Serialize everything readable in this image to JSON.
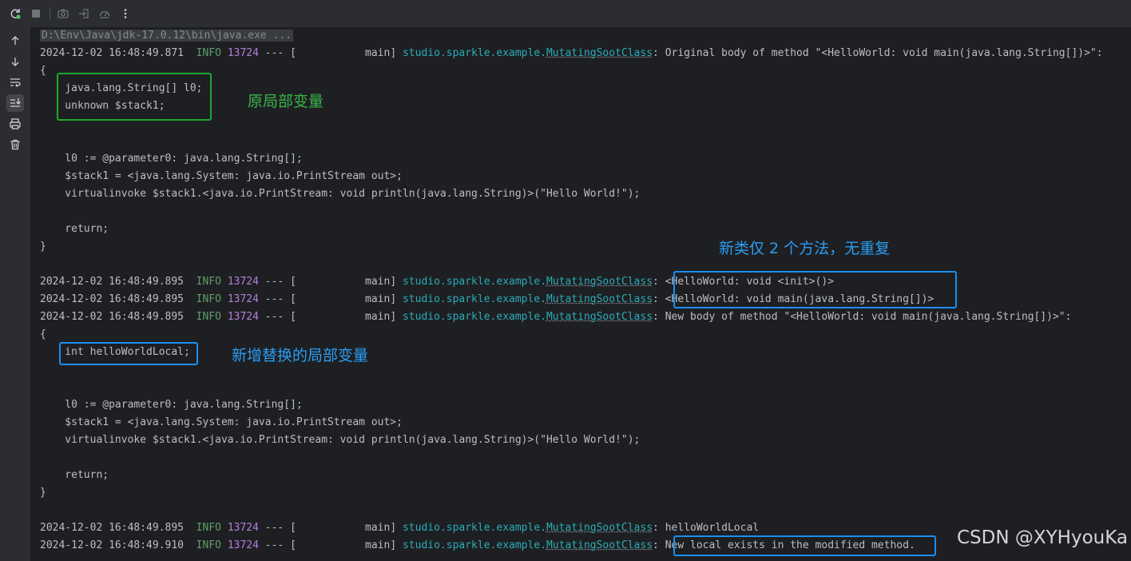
{
  "toolbar": {
    "buttons": [
      {
        "name": "rerun-icon"
      },
      {
        "name": "stop-icon"
      },
      {
        "name": "camera-icon"
      },
      {
        "name": "login-icon"
      },
      {
        "name": "gauge-icon"
      },
      {
        "name": "more-vertical-icon"
      }
    ]
  },
  "sidebar": {
    "buttons": [
      {
        "name": "arrow-up-icon"
      },
      {
        "name": "arrow-down-icon"
      },
      {
        "name": "soft-wrap-icon"
      },
      {
        "name": "scroll-to-end-icon",
        "active": true
      },
      {
        "name": "print-icon"
      },
      {
        "name": "trash-icon"
      }
    ]
  },
  "log": {
    "command": "D:\\Env\\Java\\jdk-17.0.12\\bin\\java.exe ...",
    "entries": [
      {
        "ts": "2024-12-02 16:48:49.871",
        "level": "INFO",
        "pid": "13724",
        "sep": " --- [           main] ",
        "pkg": "studio.sparkle.example.",
        "cls": "MutatingSootClass",
        "msg": ": Original body of method \"<HelloWorld: void main(java.lang.String[])>\":"
      },
      {
        "ts": "2024-12-02 16:48:49.895",
        "level": "INFO",
        "pid": "13724",
        "sep": " --- [           main] ",
        "pkg": "studio.sparkle.example.",
        "cls": "MutatingSootClass",
        "msg": ": <HelloWorld: void <init>()>"
      },
      {
        "ts": "2024-12-02 16:48:49.895",
        "level": "INFO",
        "pid": "13724",
        "sep": " --- [           main] ",
        "pkg": "studio.sparkle.example.",
        "cls": "MutatingSootClass",
        "msg": ": <HelloWorld: void main(java.lang.String[])>"
      },
      {
        "ts": "2024-12-02 16:48:49.895",
        "level": "INFO",
        "pid": "13724",
        "sep": " --- [           main] ",
        "pkg": "studio.sparkle.example.",
        "cls": "MutatingSootClass",
        "msg": ": New body of method \"<HelloWorld: void main(java.lang.String[])>\":"
      },
      {
        "ts": "2024-12-02 16:48:49.895",
        "level": "INFO",
        "pid": "13724",
        "sep": " --- [           main] ",
        "pkg": "studio.sparkle.example.",
        "cls": "MutatingSootClass",
        "msg": ": helloWorldLocal"
      },
      {
        "ts": "2024-12-02 16:48:49.910",
        "level": "INFO",
        "pid": "13724",
        "sep": " --- [           main] ",
        "pkg": "studio.sparkle.example.",
        "cls": "MutatingSootClass",
        "msg": ": New local exists in the modified method."
      }
    ],
    "body1": {
      "open": "{",
      "locals": [
        "    java.lang.String[] l0;",
        "    unknown $stack1;"
      ],
      "stmts": [
        "    l0 := @parameter0: java.lang.String[];",
        "    $stack1 = <java.lang.System: java.io.PrintStream out>;",
        "    virtualinvoke $stack1.<java.io.PrintStream: void println(java.lang.String)>(\"Hello World!\");",
        "    return;"
      ],
      "close": "}"
    },
    "body2": {
      "open": "{",
      "locals": [
        "    int helloWorldLocal;"
      ],
      "stmts": [
        "    l0 := @parameter0: java.lang.String[];",
        "    $stack1 = <java.lang.System: java.io.PrintStream out>;",
        "    virtualinvoke $stack1.<java.io.PrintStream: void println(java.lang.String)>(\"Hello World!\");",
        "    return;"
      ],
      "close": "}"
    }
  },
  "annotations": {
    "original_locals": "原局部变量",
    "two_methods": "新类仅 2 个方法，无重复",
    "new_local": "新增替换的局部变量"
  },
  "watermark": "CSDN @XYHyouKa",
  "colors": {
    "background": "#1e1f22",
    "text": "#bcbec4",
    "info": "#5f9e69",
    "pid": "#b57edc",
    "logger": "#2aacb8",
    "box_green": "#1aaa2d",
    "box_blue": "#1b8ef0"
  }
}
